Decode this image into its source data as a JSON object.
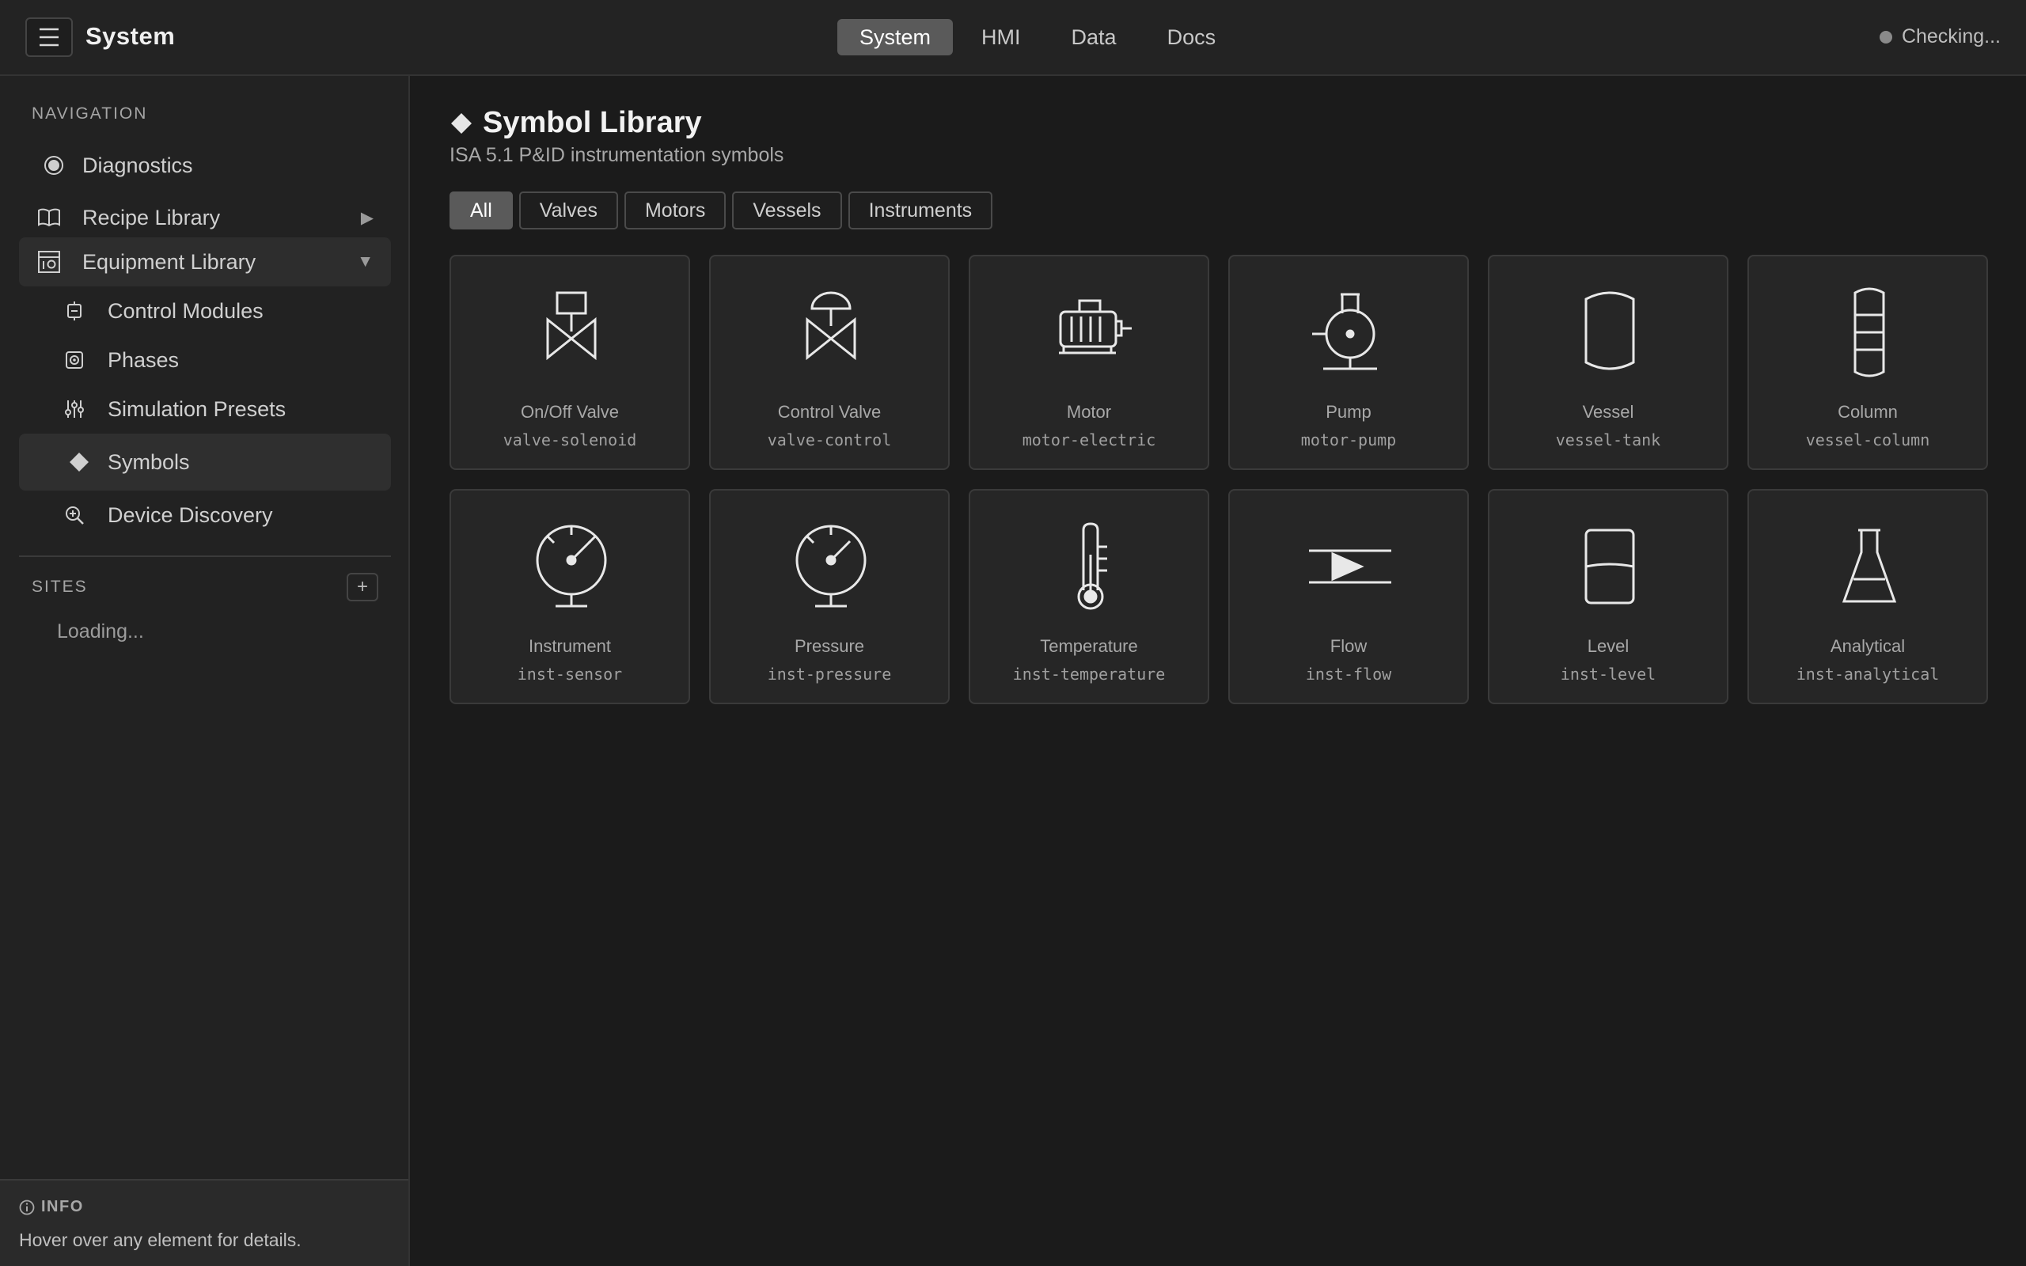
{
  "header": {
    "title": "System",
    "tabs": [
      {
        "label": "System",
        "active": true
      },
      {
        "label": "HMI"
      },
      {
        "label": "Data"
      },
      {
        "label": "Docs"
      }
    ],
    "status": "Checking..."
  },
  "sidebar": {
    "navigation_label": "NAVIGATION",
    "items": [
      {
        "label": "Diagnostics",
        "icon": "diagnostics-icon"
      },
      {
        "label": "Recipe Library",
        "icon": "book-icon",
        "arrow": "▶"
      },
      {
        "label": "Equipment Library",
        "icon": "equipment-icon",
        "arrow": "▼"
      }
    ],
    "subitems": [
      {
        "label": "Control Modules",
        "icon": "chip-icon"
      },
      {
        "label": "Phases",
        "icon": "phases-icon"
      },
      {
        "label": "Simulation Presets",
        "icon": "sliders-icon"
      },
      {
        "label": "Symbols",
        "icon": "diamond-icon",
        "selected": true
      },
      {
        "label": "Device Discovery",
        "icon": "discovery-icon"
      }
    ],
    "sites_label": "SITES",
    "add_label": "+",
    "loading": "Loading...",
    "info_label": "INFO",
    "info_text": "Hover over any element for details."
  },
  "main": {
    "title": "Symbol Library",
    "subtitle": "ISA 5.1 P&ID instrumentation symbols",
    "filters": [
      "All",
      "Valves",
      "Motors",
      "Vessels",
      "Instruments"
    ],
    "active_filter": "All",
    "symbols": [
      {
        "name": "On/Off Valve",
        "id": "valve-solenoid",
        "icon": "solenoid-valve-icon"
      },
      {
        "name": "Control Valve",
        "id": "valve-control",
        "icon": "control-valve-icon"
      },
      {
        "name": "Motor",
        "id": "motor-electric",
        "icon": "motor-icon"
      },
      {
        "name": "Pump",
        "id": "motor-pump",
        "icon": "pump-icon"
      },
      {
        "name": "Vessel",
        "id": "vessel-tank",
        "icon": "vessel-icon"
      },
      {
        "name": "Column",
        "id": "vessel-column",
        "icon": "column-icon"
      },
      {
        "name": "Instrument",
        "id": "inst-sensor",
        "icon": "gauge-icon"
      },
      {
        "name": "Pressure",
        "id": "inst-pressure",
        "icon": "pressure-gauge-icon"
      },
      {
        "name": "Temperature",
        "id": "inst-temperature",
        "icon": "thermometer-icon"
      },
      {
        "name": "Flow",
        "id": "inst-flow",
        "icon": "flow-icon"
      },
      {
        "name": "Level",
        "id": "inst-level",
        "icon": "level-icon"
      },
      {
        "name": "Analytical",
        "id": "inst-analytical",
        "icon": "flask-icon"
      }
    ]
  }
}
